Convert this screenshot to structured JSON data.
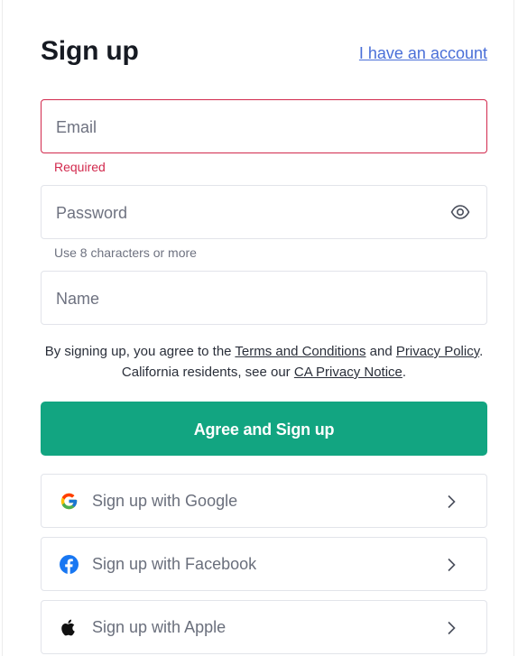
{
  "header": {
    "title": "Sign up",
    "account_link": "I have an account"
  },
  "form": {
    "email": {
      "placeholder": "Email",
      "value": "",
      "error": "Required"
    },
    "password": {
      "placeholder": "Password",
      "value": "",
      "hint": "Use 8 characters or more",
      "toggle_icon": "eye-icon"
    },
    "name": {
      "placeholder": "Name",
      "value": ""
    }
  },
  "legal": {
    "prefix": "By signing up, you agree to the ",
    "terms": "Terms and Conditions",
    "and": " and ",
    "privacy": "Privacy Policy",
    "mid": ". California residents, see our ",
    "ca_notice": "CA Privacy Notice",
    "suffix": "."
  },
  "primary_button": {
    "label": "Agree and Sign up",
    "color": "#12a581"
  },
  "social": [
    {
      "label": "Sign up with Google",
      "icon": "google-icon"
    },
    {
      "label": "Sign up with Facebook",
      "icon": "facebook-icon"
    },
    {
      "label": "Sign up with Apple",
      "icon": "apple-icon"
    }
  ],
  "colors": {
    "error": "#d2294d",
    "link": "#4a6fd8",
    "accent": "#12a581"
  }
}
